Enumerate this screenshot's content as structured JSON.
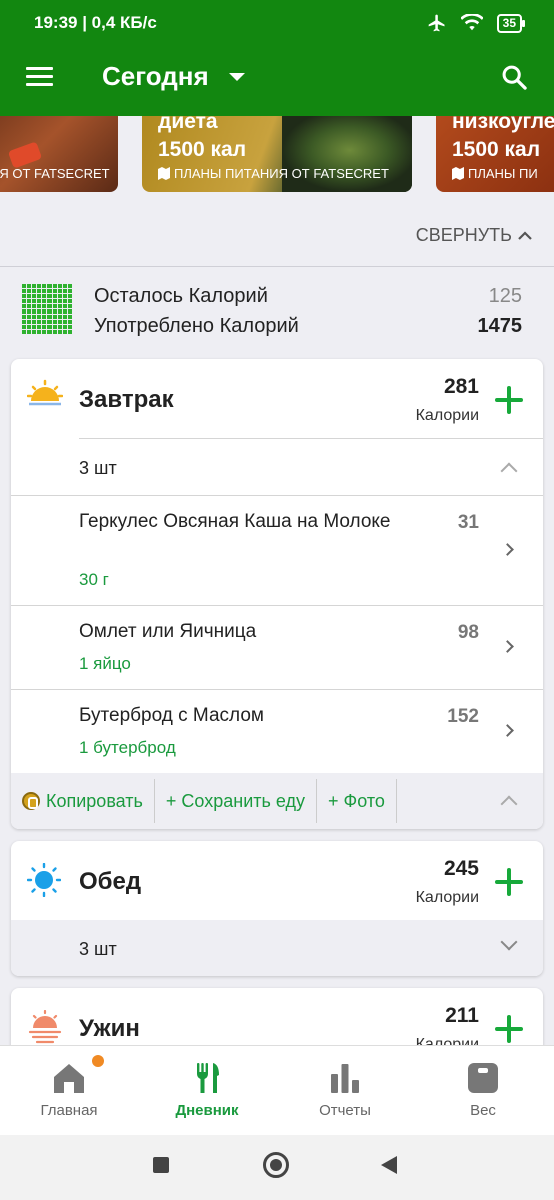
{
  "status_bar": {
    "time_info": "19:39 | 0,4 КБ/с",
    "battery": "35"
  },
  "app_bar": {
    "title": "Сегодня"
  },
  "banners": [
    {
      "line1": "",
      "line2": "",
      "sub": "ИЯ ОТ FATSECRET"
    },
    {
      "line1": "диета",
      "line2": "1500 кал",
      "sub": "ПЛАНЫ ПИТАНИЯ ОТ FATSECRET"
    },
    {
      "line1": "низкоугле",
      "line2": "1500 кал",
      "sub": "ПЛАНЫ ПИ"
    }
  ],
  "collapse_label": "СВЕРНУТЬ",
  "summary": {
    "remaining_label": "Осталось Калорий",
    "remaining_value": "125",
    "consumed_label": "Употреблено Калорий",
    "consumed_value": "1475"
  },
  "meals": {
    "breakfast": {
      "title": "Завтрак",
      "calories": "281",
      "calories_label": "Калории",
      "count": "3 шт",
      "items": [
        {
          "name": "Геркулес Овсяная Каша на Молоке",
          "qty": "30 г",
          "cal": "31"
        },
        {
          "name": "Омлет или Яичница",
          "qty": "1 яйцо",
          "cal": "98"
        },
        {
          "name": "Бутерброд с Маслом",
          "qty": "1 бутерброд",
          "cal": "152"
        }
      ],
      "actions": {
        "copy": "Копировать",
        "save": "+ Сохранить еду",
        "photo": "+ Фото"
      }
    },
    "lunch": {
      "title": "Обед",
      "calories": "245",
      "calories_label": "Калории",
      "count": "3 шт"
    },
    "dinner": {
      "title": "Ужин",
      "calories": "211",
      "calories_label": "Калории"
    }
  },
  "bottom_nav": {
    "home": "Главная",
    "diary": "Дневник",
    "reports": "Отчеты",
    "weight": "Вес"
  },
  "colors": {
    "primary": "#128710",
    "accent_green": "#17a93a",
    "text_green": "#1a9a3e",
    "notification_dot": "#f08a24"
  }
}
